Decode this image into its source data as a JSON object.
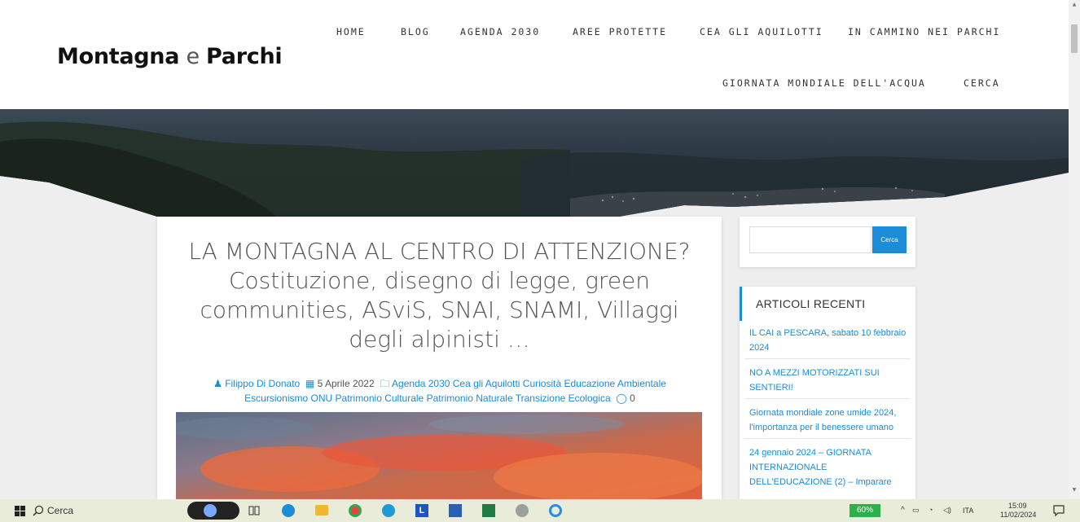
{
  "header": {
    "logo_part1": "Montagna",
    "logo_part2": "e",
    "logo_part3": "Parchi",
    "nav_row1": [
      "HOME",
      "BLOG",
      "AGENDA 2030",
      "AREE PROTETTE",
      "CEA GLI AQUILOTTI",
      "IN CAMMINO NEI PARCHI"
    ],
    "nav_row2": [
      "GIORNATA MONDIALE DELL'ACQUA",
      "CERCA"
    ]
  },
  "article": {
    "title": "LA MONTAGNA AL CENTRO DI ATTENZIONE? Costituzione, disegno di legge, green communities, ASviS, SNAI, SNAMI, Villaggi degli alpinisti …",
    "author": "Filippo Di Donato",
    "date": "5 Aprile 2022",
    "categories_line1": "Agenda 2030 Cea gli Aquilotti Curiosità Educazione Ambientale",
    "categories_line2": "Escursionismo ONU Patrimonio Culturale Patrimonio Naturale Transizione Ecologica",
    "comments": "0"
  },
  "sidebar": {
    "search_button": "Cerca",
    "recent_title": "ARTICOLI RECENTI",
    "recent_items": [
      "IL CAI a PESCARA, sabato 10 febbraio 2024",
      "NO A MEZZI MOTORIZZATI SUI SENTIERI!",
      "Giornata mondiale zone umide 2024, l'importanza per il benessere umano",
      "24 gennaio 2024 – GIORNATA INTERNAZIONALE DELL'EDUCAZIONE (2) – Imparare"
    ]
  },
  "taskbar": {
    "search_label": "Cerca",
    "battery": "60%",
    "language": "ITA",
    "time": "15:09",
    "date": "11/02/2024"
  },
  "colors": {
    "accent": "#1a8cd8",
    "taskbar": "#e9ecd8",
    "battery": "#2db04b"
  }
}
